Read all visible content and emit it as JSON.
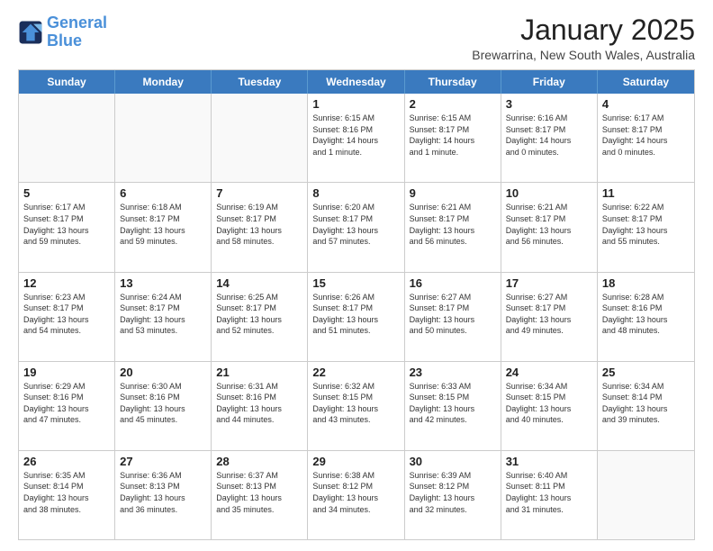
{
  "logo": {
    "line1": "General",
    "line2": "Blue"
  },
  "header": {
    "month": "January 2025",
    "location": "Brewarrina, New South Wales, Australia"
  },
  "days": [
    "Sunday",
    "Monday",
    "Tuesday",
    "Wednesday",
    "Thursday",
    "Friday",
    "Saturday"
  ],
  "weeks": [
    [
      {
        "day": "",
        "info": ""
      },
      {
        "day": "",
        "info": ""
      },
      {
        "day": "",
        "info": ""
      },
      {
        "day": "1",
        "info": "Sunrise: 6:15 AM\nSunset: 8:16 PM\nDaylight: 14 hours\nand 1 minute."
      },
      {
        "day": "2",
        "info": "Sunrise: 6:15 AM\nSunset: 8:17 PM\nDaylight: 14 hours\nand 1 minute."
      },
      {
        "day": "3",
        "info": "Sunrise: 6:16 AM\nSunset: 8:17 PM\nDaylight: 14 hours\nand 0 minutes."
      },
      {
        "day": "4",
        "info": "Sunrise: 6:17 AM\nSunset: 8:17 PM\nDaylight: 14 hours\nand 0 minutes."
      }
    ],
    [
      {
        "day": "5",
        "info": "Sunrise: 6:17 AM\nSunset: 8:17 PM\nDaylight: 13 hours\nand 59 minutes."
      },
      {
        "day": "6",
        "info": "Sunrise: 6:18 AM\nSunset: 8:17 PM\nDaylight: 13 hours\nand 59 minutes."
      },
      {
        "day": "7",
        "info": "Sunrise: 6:19 AM\nSunset: 8:17 PM\nDaylight: 13 hours\nand 58 minutes."
      },
      {
        "day": "8",
        "info": "Sunrise: 6:20 AM\nSunset: 8:17 PM\nDaylight: 13 hours\nand 57 minutes."
      },
      {
        "day": "9",
        "info": "Sunrise: 6:21 AM\nSunset: 8:17 PM\nDaylight: 13 hours\nand 56 minutes."
      },
      {
        "day": "10",
        "info": "Sunrise: 6:21 AM\nSunset: 8:17 PM\nDaylight: 13 hours\nand 56 minutes."
      },
      {
        "day": "11",
        "info": "Sunrise: 6:22 AM\nSunset: 8:17 PM\nDaylight: 13 hours\nand 55 minutes."
      }
    ],
    [
      {
        "day": "12",
        "info": "Sunrise: 6:23 AM\nSunset: 8:17 PM\nDaylight: 13 hours\nand 54 minutes."
      },
      {
        "day": "13",
        "info": "Sunrise: 6:24 AM\nSunset: 8:17 PM\nDaylight: 13 hours\nand 53 minutes."
      },
      {
        "day": "14",
        "info": "Sunrise: 6:25 AM\nSunset: 8:17 PM\nDaylight: 13 hours\nand 52 minutes."
      },
      {
        "day": "15",
        "info": "Sunrise: 6:26 AM\nSunset: 8:17 PM\nDaylight: 13 hours\nand 51 minutes."
      },
      {
        "day": "16",
        "info": "Sunrise: 6:27 AM\nSunset: 8:17 PM\nDaylight: 13 hours\nand 50 minutes."
      },
      {
        "day": "17",
        "info": "Sunrise: 6:27 AM\nSunset: 8:17 PM\nDaylight: 13 hours\nand 49 minutes."
      },
      {
        "day": "18",
        "info": "Sunrise: 6:28 AM\nSunset: 8:16 PM\nDaylight: 13 hours\nand 48 minutes."
      }
    ],
    [
      {
        "day": "19",
        "info": "Sunrise: 6:29 AM\nSunset: 8:16 PM\nDaylight: 13 hours\nand 47 minutes."
      },
      {
        "day": "20",
        "info": "Sunrise: 6:30 AM\nSunset: 8:16 PM\nDaylight: 13 hours\nand 45 minutes."
      },
      {
        "day": "21",
        "info": "Sunrise: 6:31 AM\nSunset: 8:16 PM\nDaylight: 13 hours\nand 44 minutes."
      },
      {
        "day": "22",
        "info": "Sunrise: 6:32 AM\nSunset: 8:15 PM\nDaylight: 13 hours\nand 43 minutes."
      },
      {
        "day": "23",
        "info": "Sunrise: 6:33 AM\nSunset: 8:15 PM\nDaylight: 13 hours\nand 42 minutes."
      },
      {
        "day": "24",
        "info": "Sunrise: 6:34 AM\nSunset: 8:15 PM\nDaylight: 13 hours\nand 40 minutes."
      },
      {
        "day": "25",
        "info": "Sunrise: 6:34 AM\nSunset: 8:14 PM\nDaylight: 13 hours\nand 39 minutes."
      }
    ],
    [
      {
        "day": "26",
        "info": "Sunrise: 6:35 AM\nSunset: 8:14 PM\nDaylight: 13 hours\nand 38 minutes."
      },
      {
        "day": "27",
        "info": "Sunrise: 6:36 AM\nSunset: 8:13 PM\nDaylight: 13 hours\nand 36 minutes."
      },
      {
        "day": "28",
        "info": "Sunrise: 6:37 AM\nSunset: 8:13 PM\nDaylight: 13 hours\nand 35 minutes."
      },
      {
        "day": "29",
        "info": "Sunrise: 6:38 AM\nSunset: 8:12 PM\nDaylight: 13 hours\nand 34 minutes."
      },
      {
        "day": "30",
        "info": "Sunrise: 6:39 AM\nSunset: 8:12 PM\nDaylight: 13 hours\nand 32 minutes."
      },
      {
        "day": "31",
        "info": "Sunrise: 6:40 AM\nSunset: 8:11 PM\nDaylight: 13 hours\nand 31 minutes."
      },
      {
        "day": "",
        "info": ""
      }
    ]
  ]
}
